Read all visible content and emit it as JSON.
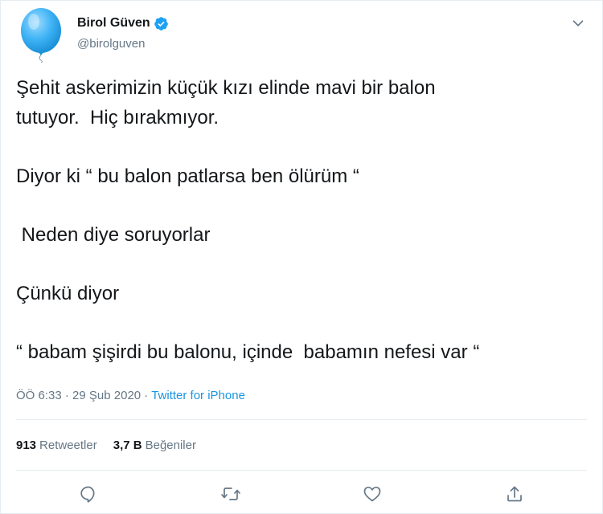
{
  "author": {
    "name": "Birol Güven",
    "handle": "@birolguven",
    "avatar_icon": "blue-balloon-avatar",
    "verified_icon": "verified-badge-icon"
  },
  "tweet": {
    "lines": [
      "Şehit askerimizin küçük kızı elinde mavi bir balon",
      "tutuyor.  Hiç bırakmıyor.",
      "",
      "Diyor ki “ bu balon patlarsa ben ölürüm “",
      "",
      " Neden diye soruyorlar",
      "",
      "Çünkü diyor",
      "",
      "“ babam şişirdi bu balonu, içinde  babamın nefesi var “"
    ]
  },
  "meta": {
    "time": "ÖÖ 6:33",
    "separator": "·",
    "date": "29 Şub 2020",
    "source": "Twitter for iPhone"
  },
  "stats": {
    "retweets_count": "913",
    "retweets_label": "Retweetler",
    "likes_count": "3,7 B",
    "likes_label": "Beğeniler"
  },
  "actions": [
    "reply-icon",
    "retweet-icon",
    "like-icon",
    "share-icon"
  ],
  "colors": {
    "accent": "#1da1f2",
    "link": "#1b95e0",
    "muted": "#657786",
    "text": "#14171a",
    "border": "#e6ecf0"
  }
}
